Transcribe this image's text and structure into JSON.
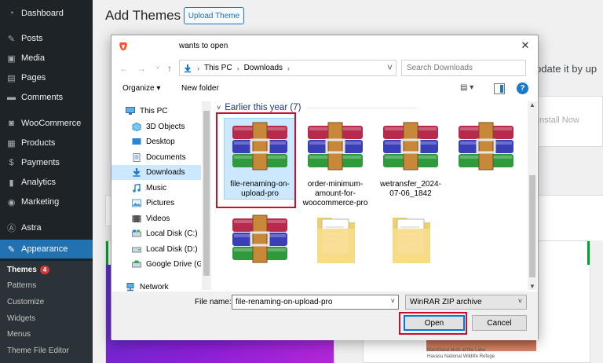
{
  "wp": {
    "menu": [
      {
        "label": "Dashboard",
        "icon": "dashboard-icon"
      },
      {
        "label": "Posts",
        "icon": "pin-icon"
      },
      {
        "label": "Media",
        "icon": "media-icon"
      },
      {
        "label": "Pages",
        "icon": "pages-icon"
      },
      {
        "label": "Comments",
        "icon": "comments-icon"
      },
      {
        "label": "WooCommerce",
        "icon": "woocommerce-icon"
      },
      {
        "label": "Products",
        "icon": "products-icon"
      },
      {
        "label": "Payments",
        "icon": "payments-icon"
      },
      {
        "label": "Analytics",
        "icon": "analytics-icon"
      },
      {
        "label": "Marketing",
        "icon": "marketing-icon"
      },
      {
        "label": "Astra",
        "icon": "astra-icon"
      },
      {
        "label": "Appearance",
        "icon": "appearance-icon"
      }
    ],
    "submenu": {
      "themes": "Themes",
      "themes_badge": "4",
      "patterns": "Patterns",
      "customize": "Customize",
      "widgets": "Widgets",
      "menus": "Menus",
      "theme_file_editor": "Theme File Editor"
    },
    "page_title": "Add Themes",
    "upload_theme": "Upload Theme",
    "bg_update_text": "pdate it by up",
    "bg_install_now": "Install Now",
    "bg_caption": "Marshland birds at the Lake Havasu National Wildlife Refuge"
  },
  "dialog": {
    "title": "wants to open",
    "close": "✕",
    "breadcrumb": [
      "This PC",
      "Downloads"
    ],
    "search_placeholder": "Search Downloads",
    "organize": "Organize ▾",
    "new_folder": "New folder",
    "help": "?",
    "nav": [
      {
        "label": "This PC",
        "icon": "computer-icon"
      },
      {
        "label": "3D Objects",
        "icon": "cube-icon"
      },
      {
        "label": "Desktop",
        "icon": "desktop-icon"
      },
      {
        "label": "Documents",
        "icon": "documents-icon"
      },
      {
        "label": "Downloads",
        "icon": "download-arrow-icon",
        "selected": true
      },
      {
        "label": "Music",
        "icon": "music-icon"
      },
      {
        "label": "Pictures",
        "icon": "pictures-icon"
      },
      {
        "label": "Videos",
        "icon": "videos-icon"
      },
      {
        "label": "Local Disk (C:)",
        "icon": "drive-icon"
      },
      {
        "label": "Local Disk (D:)",
        "icon": "drive-icon"
      },
      {
        "label": "Google Drive (G:)",
        "icon": "google-drive-icon"
      },
      {
        "label": "Network",
        "icon": "network-icon"
      }
    ],
    "group_header": "Earlier this year (7)",
    "files": [
      {
        "name": "file-renaming-on-upload-pro",
        "type": "winrar",
        "selected": true
      },
      {
        "name": "order-minimum-amount-for-woocommerce-pro",
        "type": "winrar"
      },
      {
        "name": "wetransfer_2024-07-06_1842",
        "type": "winrar"
      },
      {
        "name": "",
        "type": "winrar"
      },
      {
        "name": "",
        "type": "winrar"
      },
      {
        "name": "",
        "type": "folder"
      },
      {
        "name": "",
        "type": "folder"
      }
    ],
    "file_name_label": "File name:",
    "file_name_value": "file-renaming-on-upload-pro",
    "filter": "WinRAR ZIP archive",
    "open": "Open",
    "cancel": "Cancel"
  },
  "colors": {
    "wp_sidebar": "#1d2327",
    "wp_active": "#2271b1",
    "highlight_red": "#c8102e",
    "selection": "#cce8ff",
    "accent_blue": "#0078d7"
  }
}
